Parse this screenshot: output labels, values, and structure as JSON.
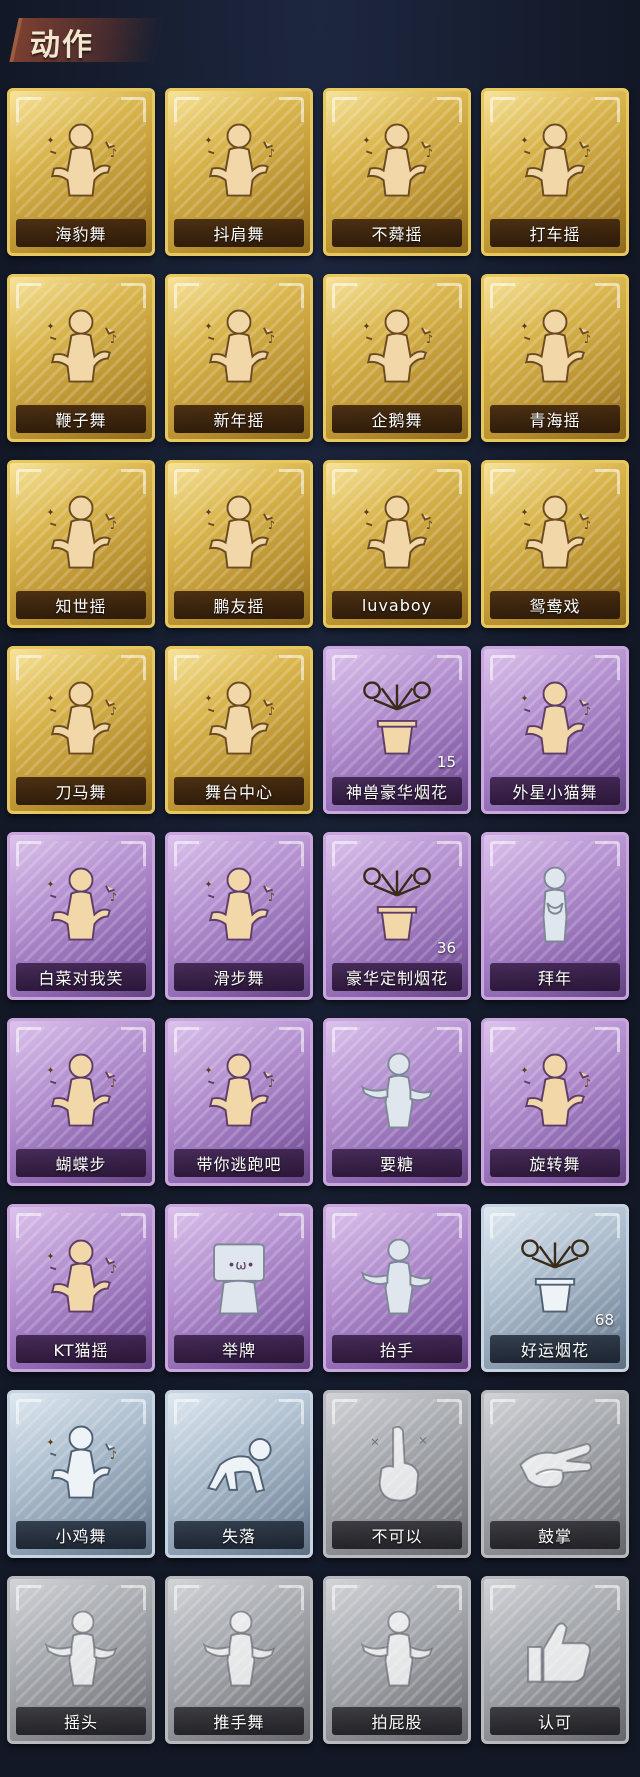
{
  "section": {
    "title": "动作"
  },
  "rarity_colors": {
    "gold": "#d9b54d",
    "purple": "#b38fcf",
    "silver": "#aebfcf",
    "gray": "#a7aaae"
  },
  "items": [
    {
      "label": "海豹舞",
      "rarity": "gold",
      "icon": "dance-figure-icon"
    },
    {
      "label": "抖肩舞",
      "rarity": "gold",
      "icon": "dance-figure-icon"
    },
    {
      "label": "不蕣摇",
      "rarity": "gold",
      "icon": "dance-figure-icon"
    },
    {
      "label": "打车摇",
      "rarity": "gold",
      "icon": "dance-figure-icon"
    },
    {
      "label": "鞭子舞",
      "rarity": "gold",
      "icon": "dance-figure-icon"
    },
    {
      "label": "新年摇",
      "rarity": "gold",
      "icon": "dance-figure-icon"
    },
    {
      "label": "企鹅舞",
      "rarity": "gold",
      "icon": "dance-figure-icon"
    },
    {
      "label": "青海摇",
      "rarity": "gold",
      "icon": "dance-figure-icon"
    },
    {
      "label": "知世摇",
      "rarity": "gold",
      "icon": "dance-figure-icon"
    },
    {
      "label": "鹏友摇",
      "rarity": "gold",
      "icon": "dance-figure-icon"
    },
    {
      "label": "luvaboy",
      "rarity": "gold",
      "icon": "dance-figure-icon"
    },
    {
      "label": "鸳鸯戏",
      "rarity": "gold",
      "icon": "dance-figure-icon"
    },
    {
      "label": "刀马舞",
      "rarity": "gold",
      "icon": "dance-figure-icon"
    },
    {
      "label": "舞台中心",
      "rarity": "gold",
      "icon": "dance-figure-icon"
    },
    {
      "label": "神兽豪华烟花",
      "rarity": "purple",
      "icon": "firework-icon",
      "count": "15"
    },
    {
      "label": "外星小猫舞",
      "rarity": "purple",
      "icon": "dance-figure-icon"
    },
    {
      "label": "白菜对我笑",
      "rarity": "purple",
      "icon": "dance-figure-icon"
    },
    {
      "label": "滑步舞",
      "rarity": "purple",
      "icon": "dance-figure-icon"
    },
    {
      "label": "豪华定制烟花",
      "rarity": "purple",
      "icon": "firework-icon",
      "count": "36"
    },
    {
      "label": "拜年",
      "rarity": "purple",
      "icon": "bow-figure-icon",
      "pale": true
    },
    {
      "label": "蝴蝶步",
      "rarity": "purple",
      "icon": "dance-figure-icon"
    },
    {
      "label": "带你逃跑吧",
      "rarity": "purple",
      "icon": "dance-figure-icon"
    },
    {
      "label": "要糖",
      "rarity": "purple",
      "icon": "ghost-figure-icon",
      "pale": true
    },
    {
      "label": "旋转舞",
      "rarity": "purple",
      "icon": "dance-figure-icon"
    },
    {
      "label": "KT猫摇",
      "rarity": "purple",
      "icon": "dance-figure-icon"
    },
    {
      "label": "举牌",
      "rarity": "purple",
      "icon": "sign-figure-icon",
      "pale": true
    },
    {
      "label": "抬手",
      "rarity": "purple",
      "icon": "ghost-figure-icon",
      "pale": true
    },
    {
      "label": "好运烟花",
      "rarity": "silver",
      "icon": "firework-icon",
      "count": "68"
    },
    {
      "label": "小鸡舞",
      "rarity": "silver",
      "icon": "dance-figure-icon"
    },
    {
      "label": "失落",
      "rarity": "silver",
      "icon": "crawl-figure-icon"
    },
    {
      "label": "不可以",
      "rarity": "gray",
      "icon": "finger-icon"
    },
    {
      "label": "鼓掌",
      "rarity": "gray",
      "icon": "clap-icon"
    },
    {
      "label": "摇头",
      "rarity": "gray",
      "icon": "ghost-figure-icon"
    },
    {
      "label": "推手舞",
      "rarity": "gray",
      "icon": "ghost-figure-icon"
    },
    {
      "label": "拍屁股",
      "rarity": "gray",
      "icon": "ghost-figure-icon"
    },
    {
      "label": "认可",
      "rarity": "gray",
      "icon": "thumbs-up-icon"
    }
  ]
}
